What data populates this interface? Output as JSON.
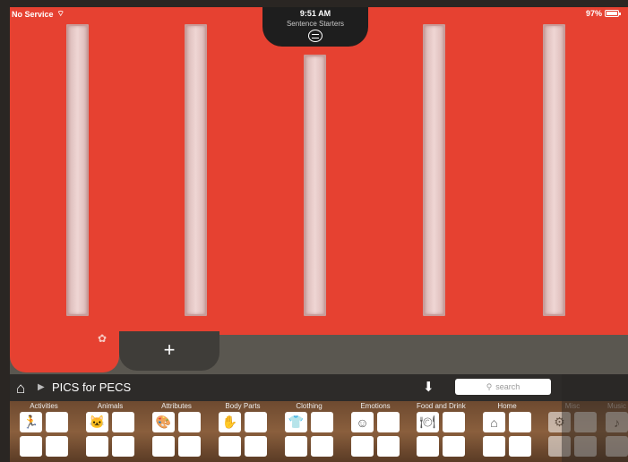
{
  "status": {
    "carrier": "No Service",
    "time": "9:51 AM",
    "battery": "97%"
  },
  "board": {
    "title": "Sentence Starters",
    "strip_count": 5
  },
  "tabs": {
    "add_label": "+"
  },
  "nav": {
    "breadcrumb": "PICS for PECS",
    "search_placeholder": "search"
  },
  "categories": [
    {
      "label": "Activities"
    },
    {
      "label": "Animals"
    },
    {
      "label": "Attributes"
    },
    {
      "label": "Body Parts"
    },
    {
      "label": "Clothing"
    },
    {
      "label": "Emotions"
    },
    {
      "label": "Food and Drink"
    },
    {
      "label": "Home"
    },
    {
      "label": "Misc"
    },
    {
      "label": "Music"
    }
  ],
  "colors": {
    "board": "#e64131",
    "tabbar": "#5a5750",
    "navbar": "#2d2b29"
  }
}
